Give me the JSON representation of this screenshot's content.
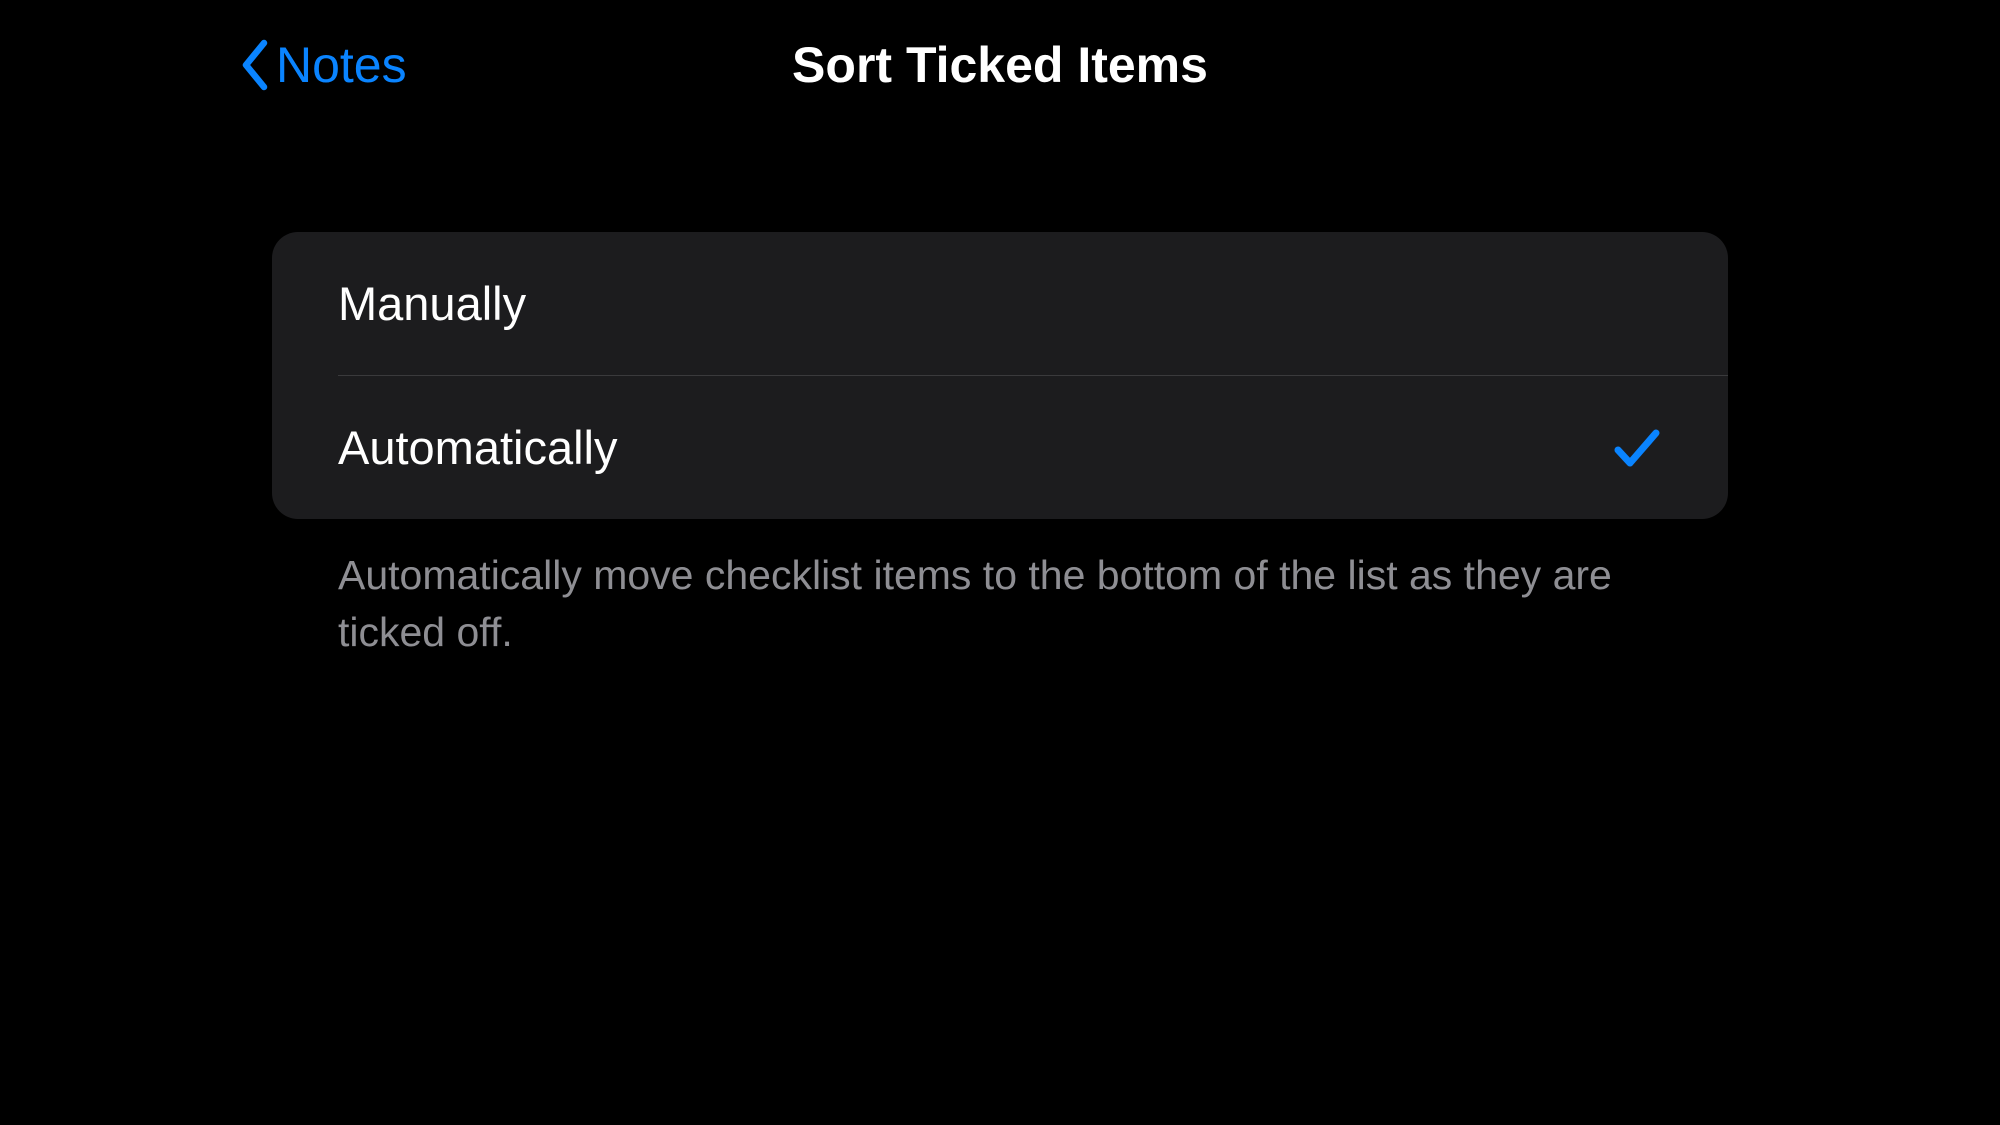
{
  "colors": {
    "accent": "#0a84ff",
    "background": "#000000",
    "groupBackground": "#1c1c1e",
    "textPrimary": "#ffffff",
    "textSecondary": "#8e8e93"
  },
  "nav": {
    "backLabel": "Notes",
    "title": "Sort Ticked Items"
  },
  "options": {
    "manually": {
      "label": "Manually",
      "selected": false
    },
    "automatically": {
      "label": "Automatically",
      "selected": true
    }
  },
  "footer": "Automatically move checklist items to the bottom of the list as they are ticked off."
}
